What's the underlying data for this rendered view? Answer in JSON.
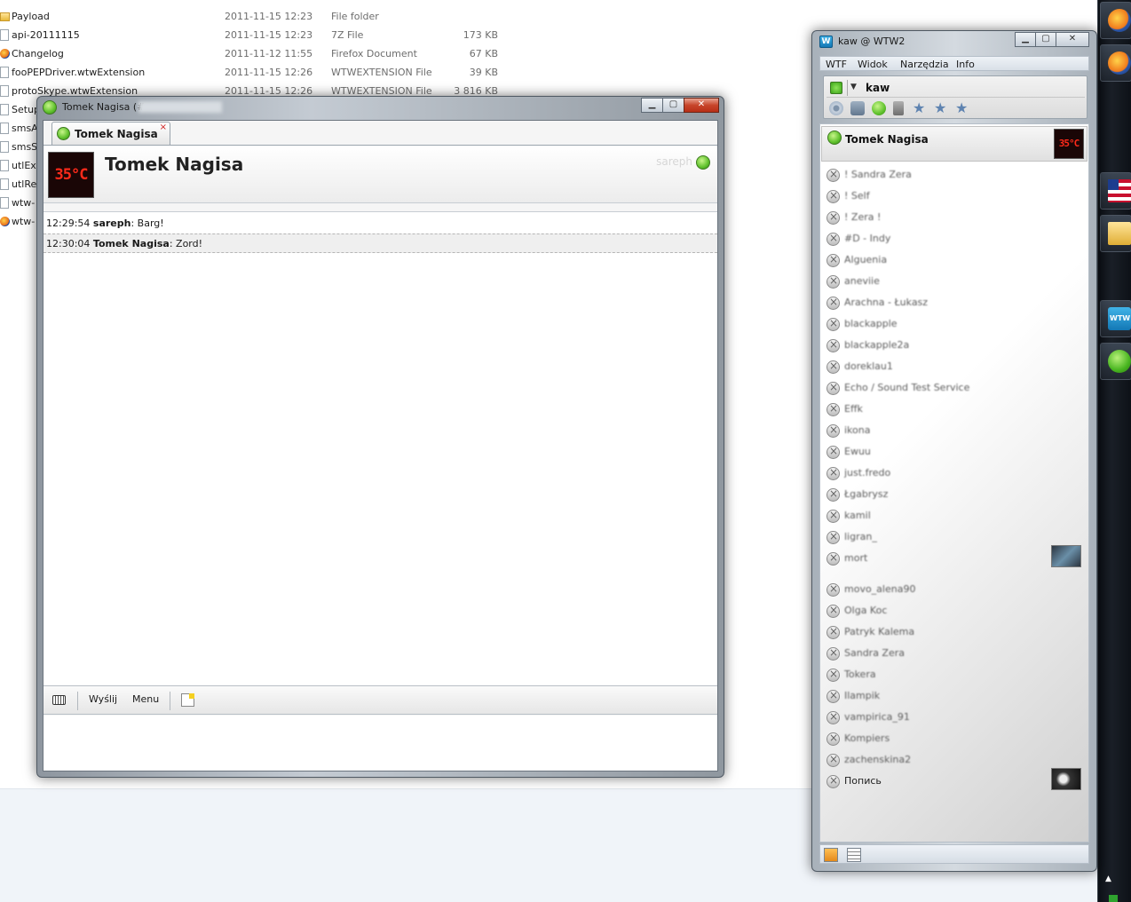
{
  "explorer": {
    "files": [
      {
        "name": "Payload",
        "date": "2011-11-15 12:23",
        "type": "File folder",
        "size": "",
        "icon": "folder-icon"
      },
      {
        "name": "api-20111115",
        "date": "2011-11-15 12:23",
        "type": "7Z File",
        "size": "173 KB",
        "icon": "archive-icon"
      },
      {
        "name": "Changelog",
        "date": "2011-11-12 11:55",
        "type": "Firefox Document",
        "size": "67 KB",
        "icon": "firefox-icon"
      },
      {
        "name": "fooPEPDriver.wtwExtension",
        "date": "2011-11-15 12:26",
        "type": "WTWEXTENSION File",
        "size": "39 KB",
        "icon": "file-icon"
      },
      {
        "name": "protoSkype.wtwExtension",
        "date": "2011-11-15 12:26",
        "type": "WTWEXTENSION File",
        "size": "3 816 KB",
        "icon": "file-icon"
      },
      {
        "name": "Setup",
        "date": "",
        "type": "",
        "size": "",
        "icon": "setup-icon"
      },
      {
        "name": "smsA",
        "date": "",
        "type": "",
        "size": "",
        "icon": "file-icon"
      },
      {
        "name": "smsSt",
        "date": "",
        "type": "",
        "size": "",
        "icon": "file-icon"
      },
      {
        "name": "utlEx",
        "date": "",
        "type": "",
        "size": "",
        "icon": "file-icon"
      },
      {
        "name": "utlRe",
        "date": "",
        "type": "",
        "size": "",
        "icon": "file-icon"
      },
      {
        "name": "wtw-",
        "date": "",
        "type": "",
        "size": "",
        "icon": "file-icon"
      },
      {
        "name": "wtw-",
        "date": "",
        "type": "",
        "size": "",
        "icon": "file-icon"
      }
    ]
  },
  "chat": {
    "window_title": "Tomek Nagisa (#",
    "tab_label": "Tomek Nagisa",
    "tab_close": "×",
    "contact_name": "Tomek Nagisa",
    "avatar_text": "35°C",
    "my_nick": "sareph",
    "messages": [
      {
        "time": "12:29:54",
        "author": "sareph",
        "text": ": Barg!"
      },
      {
        "time": "12:30:04",
        "author": "Tomek Nagisa",
        "text": ": Zord!"
      }
    ],
    "toolbar": {
      "send": "Wyślij",
      "menu": "Menu"
    },
    "input_value": ""
  },
  "contact_list": {
    "window_title": "kaw @ WTW2",
    "app_icon_letter": "W",
    "menu": [
      "WTF",
      "Widok",
      "Narzędzia",
      "Info"
    ],
    "my_name": "kaw",
    "active_contact": {
      "name": "Tomek Nagisa",
      "avatar_text": "35°C"
    },
    "contacts": [
      "! Sandra Zera",
      "! Self",
      "! Zera !",
      "#D - Indy",
      "Alguenia",
      "aneviie",
      "Arachna - Łukasz",
      "blackapple",
      "blackapple2a",
      "doreklau1",
      "Echo / Sound Test Service",
      "Effk",
      "ikona",
      "Ewuu",
      "just.fredo",
      "Łgabrysz",
      "kamil",
      "ligran_",
      "mort",
      "movo_alena90",
      "Olga Koc",
      "Patryk Kalema",
      "Sandra Zera",
      "Tokera",
      "Ilampik",
      "vampirica_91",
      "Kompiers",
      "zachenskina2",
      "Попись"
    ]
  }
}
